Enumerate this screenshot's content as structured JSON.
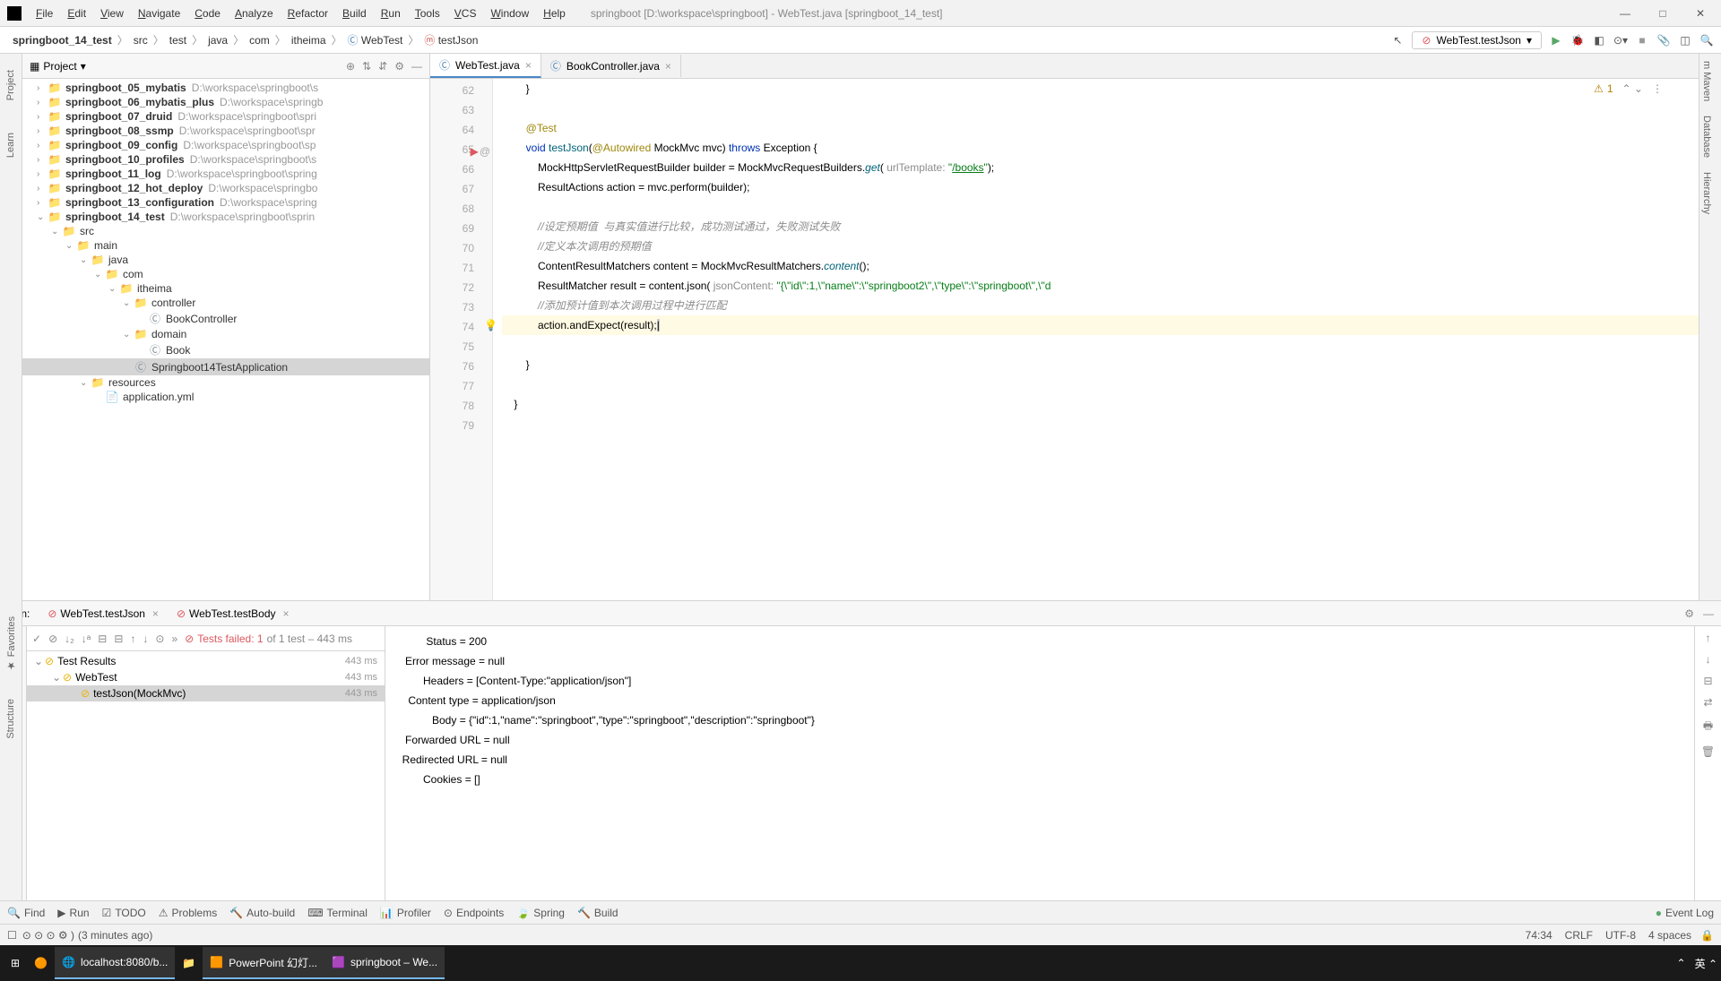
{
  "title": "springboot [D:\\workspace\\springboot] - WebTest.java [springboot_14_test]",
  "menu": [
    "File",
    "Edit",
    "View",
    "Navigate",
    "Code",
    "Analyze",
    "Refactor",
    "Build",
    "Run",
    "Tools",
    "VCS",
    "Window",
    "Help"
  ],
  "breadcrumb": [
    "springboot_14_test",
    "src",
    "test",
    "java",
    "com",
    "itheima",
    "WebTest",
    "testJson"
  ],
  "run_config": "WebTest.testJson",
  "project_label": "Project",
  "tree": [
    {
      "indent": 1,
      "chev": "›",
      "icon": "📁",
      "label": "springboot_05_mybatis",
      "path": "D:\\workspace\\springboot\\s"
    },
    {
      "indent": 1,
      "chev": "›",
      "icon": "📁",
      "label": "springboot_06_mybatis_plus",
      "path": "D:\\workspace\\springb"
    },
    {
      "indent": 1,
      "chev": "›",
      "icon": "📁",
      "label": "springboot_07_druid",
      "path": "D:\\workspace\\springboot\\spri"
    },
    {
      "indent": 1,
      "chev": "›",
      "icon": "📁",
      "label": "springboot_08_ssmp",
      "path": "D:\\workspace\\springboot\\spr"
    },
    {
      "indent": 1,
      "chev": "›",
      "icon": "📁",
      "label": "springboot_09_config",
      "path": "D:\\workspace\\springboot\\sp"
    },
    {
      "indent": 1,
      "chev": "›",
      "icon": "📁",
      "label": "springboot_10_profiles",
      "path": "D:\\workspace\\springboot\\s"
    },
    {
      "indent": 1,
      "chev": "›",
      "icon": "📁",
      "label": "springboot_11_log",
      "path": "D:\\workspace\\springboot\\spring"
    },
    {
      "indent": 1,
      "chev": "›",
      "icon": "📁",
      "label": "springboot_12_hot_deploy",
      "path": "D:\\workspace\\springbo"
    },
    {
      "indent": 1,
      "chev": "›",
      "icon": "📁",
      "label": "springboot_13_configuration",
      "path": "D:\\workspace\\spring"
    },
    {
      "indent": 1,
      "chev": "⌄",
      "icon": "📁",
      "label": "springboot_14_test",
      "path": "D:\\workspace\\springboot\\sprin"
    },
    {
      "indent": 2,
      "chev": "⌄",
      "icon": "📁",
      "label": "src",
      "path": ""
    },
    {
      "indent": 3,
      "chev": "⌄",
      "icon": "📁",
      "label": "main",
      "path": ""
    },
    {
      "indent": 4,
      "chev": "⌄",
      "icon": "📁",
      "label": "java",
      "path": "",
      "blue": true
    },
    {
      "indent": 5,
      "chev": "⌄",
      "icon": "📁",
      "label": "com",
      "path": ""
    },
    {
      "indent": 6,
      "chev": "⌄",
      "icon": "📁",
      "label": "itheima",
      "path": ""
    },
    {
      "indent": 7,
      "chev": "⌄",
      "icon": "📁",
      "label": "controller",
      "path": ""
    },
    {
      "indent": 8,
      "chev": "",
      "icon": "Ⓒ",
      "label": "BookController",
      "path": ""
    },
    {
      "indent": 7,
      "chev": "⌄",
      "icon": "📁",
      "label": "domain",
      "path": ""
    },
    {
      "indent": 8,
      "chev": "",
      "icon": "Ⓒ",
      "label": "Book",
      "path": ""
    },
    {
      "indent": 7,
      "chev": "",
      "icon": "Ⓒ",
      "label": "Springboot14TestApplication",
      "path": "",
      "selected": true
    },
    {
      "indent": 4,
      "chev": "⌄",
      "icon": "📁",
      "label": "resources",
      "path": ""
    },
    {
      "indent": 5,
      "chev": "",
      "icon": "📄",
      "label": "application.yml",
      "path": ""
    }
  ],
  "editor_tabs": [
    {
      "name": "WebTest.java",
      "active": true
    },
    {
      "name": "BookController.java",
      "active": false
    }
  ],
  "warn_count": "1",
  "gutter": [
    "62",
    "63",
    "64",
    "65",
    "66",
    "67",
    "68",
    "69",
    "70",
    "71",
    "72",
    "73",
    "74",
    "75",
    "76",
    "77",
    "78",
    "79"
  ],
  "code_lines": [
    {
      "n": 62,
      "html": "        }"
    },
    {
      "n": 63,
      "html": ""
    },
    {
      "n": 64,
      "html": "        <span class='anno'>@Test</span>"
    },
    {
      "n": 65,
      "html": "        <span class='kw'>void</span> <span style='color:#00627a'>testJson</span>(<span class='anno'>@Autowired</span> MockMvc mvc) <span class='kw'>throws</span> Exception {"
    },
    {
      "n": 66,
      "html": "            MockHttpServletRequestBuilder builder = MockMvcRequestBuilders.<span class='method'>get</span>( <span class='param'>urlTemplate:</span> <span class='str'>\"<u>/books</u>\"</span>);"
    },
    {
      "n": 67,
      "html": "            ResultActions action = mvc.perform(builder);"
    },
    {
      "n": 68,
      "html": ""
    },
    {
      "n": 69,
      "html": "            <span class='cmt'>//设定预期值  与真实值进行比较，成功测试通过，失败测试失败</span>"
    },
    {
      "n": 70,
      "html": "            <span class='cmt'>//定义本次调用的预期值</span>"
    },
    {
      "n": 71,
      "html": "            ContentResultMatchers content = MockMvcResultMatchers.<span class='method'>content</span>();"
    },
    {
      "n": 72,
      "html": "            ResultMatcher result = content.json( <span class='param'>jsonContent:</span> <span class='str'>\"{\\\"id\\\":1,\\\"name\\\":\\\"springboot2\\\",\\\"type\\\":\\\"springboot\\\",\\\"d</span>"
    },
    {
      "n": 73,
      "html": "            <span class='cmt'>//添加预计值到本次调用过程中进行匹配</span>"
    },
    {
      "n": 74,
      "html": "            action.andExpect(result);<span style='background:#ccc;'>|</span>",
      "hl": true,
      "bulb": true
    },
    {
      "n": 75,
      "html": ""
    },
    {
      "n": 76,
      "html": "        }"
    },
    {
      "n": 77,
      "html": ""
    },
    {
      "n": 78,
      "html": "    }"
    },
    {
      "n": 79,
      "html": ""
    }
  ],
  "run_label": "Run:",
  "run_tabs": [
    {
      "name": "WebTest.testJson",
      "close": true
    },
    {
      "name": "WebTest.testBody",
      "close": true
    }
  ],
  "test_status": "Tests failed: 1",
  "test_status_suffix": " of 1 test – 443 ms",
  "test_tree": [
    {
      "indent": 0,
      "chev": "⌄",
      "icon": "⊘",
      "label": "Test Results",
      "time": "443 ms"
    },
    {
      "indent": 1,
      "chev": "⌄",
      "icon": "⊘",
      "label": "WebTest",
      "time": "443 ms"
    },
    {
      "indent": 2,
      "chev": "",
      "icon": "⊘",
      "label": "testJson(MockMvc)",
      "time": "443 ms",
      "sel": true
    }
  ],
  "console_lines": [
    "          Status = 200",
    "   Error message = null",
    "         Headers = [Content-Type:\"application/json\"]",
    "    Content type = application/json",
    "            Body = {\"id\":1,\"name\":\"springboot\",\"type\":\"springboot\",\"description\":\"springboot\"}",
    "   Forwarded URL = null",
    "  Redirected URL = null",
    "         Cookies = []"
  ],
  "bottom_bar": [
    "Find",
    "Run",
    "TODO",
    "Problems",
    "Auto-build",
    "Terminal",
    "Profiler",
    "Endpoints",
    "Spring",
    "Build"
  ],
  "event_log": "Event Log",
  "status_msg": "(3 minutes ago)",
  "status_right": [
    "74:34",
    "CRLF",
    "UTF-8",
    "4 spaces"
  ],
  "taskbar": [
    {
      "icon": "⊞",
      "label": ""
    },
    {
      "icon": "🟠",
      "label": ""
    },
    {
      "icon": "🌐",
      "label": "localhost:8080/b...",
      "active": true
    },
    {
      "icon": "📁",
      "label": ""
    },
    {
      "icon": "🟧",
      "label": "PowerPoint 幻灯...",
      "active": true
    },
    {
      "icon": "🟪",
      "label": "springboot – We...",
      "active": true
    }
  ],
  "task_right": "英  ⌃"
}
